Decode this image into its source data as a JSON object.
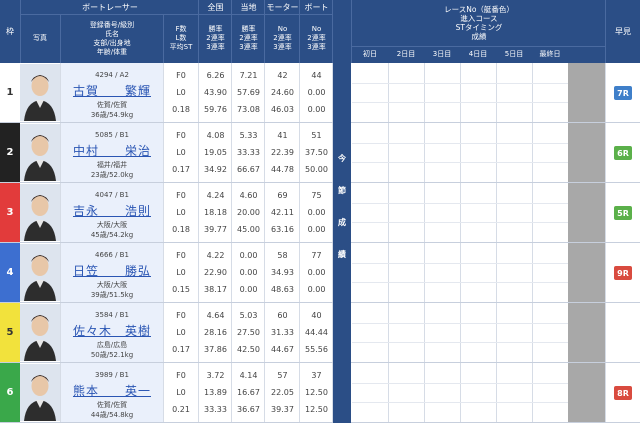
{
  "header": {
    "frame": "枠",
    "photo": "写真",
    "boat_racer": "ボートレーサー",
    "racer_info": "登録番号/級別\n氏名\n支部/出身地\n年齢/体重",
    "st_info": "F数\nL数\n平均ST",
    "national": "全国",
    "national_sub": "勝率\n2連率\n3連率",
    "local": "当地",
    "local_sub": "勝率\n2連率\n3連率",
    "motor": "モーター",
    "motor_sub": "No\n2連率\n3連率",
    "boat": "ボート",
    "boat_sub": "No\n2連率\n3連率",
    "race_header": "レースNo（艇番色）\n進入コース\nSTタイミング\n成績",
    "days": [
      "初日",
      "2日目",
      "3日目",
      "4日目",
      "5日目",
      "最終日"
    ],
    "early": "早見"
  },
  "side_label": [
    "今",
    "節",
    "成",
    "績"
  ],
  "racers": [
    {
      "frame": "1",
      "frame_color": "#ffffff",
      "frame_text": "#333333",
      "reg": "4294 / A2",
      "name": "古賀　　繁輝",
      "branch": "佐賀/佐賀",
      "age": "36歳/54.9kg",
      "f": "F0",
      "l": "L0",
      "st": "0.18",
      "national": [
        "6.26",
        "43.90",
        "59.76"
      ],
      "local": [
        "7.21",
        "57.69",
        "73.08"
      ],
      "motor": [
        "42",
        "24.60",
        "46.03"
      ],
      "boat": [
        "44",
        "0.00",
        "0.00"
      ],
      "early": "7R",
      "early_color": "#3f7fc9"
    },
    {
      "frame": "2",
      "frame_color": "#222222",
      "frame_text": "#ffffff",
      "reg": "5085 / B1",
      "name": "中村　　栄治",
      "branch": "福井/福井",
      "age": "23歳/52.0kg",
      "f": "F0",
      "l": "L0",
      "st": "0.17",
      "national": [
        "4.08",
        "19.05",
        "34.92"
      ],
      "local": [
        "5.33",
        "33.33",
        "66.67"
      ],
      "motor": [
        "41",
        "22.39",
        "44.78"
      ],
      "boat": [
        "51",
        "37.50",
        "50.00"
      ],
      "early": "6R",
      "early_color": "#5bb04a"
    },
    {
      "frame": "3",
      "frame_color": "#e23b3b",
      "frame_text": "#ffffff",
      "reg": "4047 / B1",
      "name": "吉永　　浩則",
      "branch": "大阪/大阪",
      "age": "45歳/54.2kg",
      "f": "F0",
      "l": "L0",
      "st": "0.18",
      "national": [
        "4.24",
        "18.18",
        "39.77"
      ],
      "local": [
        "4.60",
        "20.00",
        "45.00"
      ],
      "motor": [
        "69",
        "42.11",
        "63.16"
      ],
      "boat": [
        "75",
        "0.00",
        "0.00"
      ],
      "early": "5R",
      "early_color": "#5bb04a"
    },
    {
      "frame": "4",
      "frame_color": "#3d6fd0",
      "frame_text": "#ffffff",
      "reg": "4666 / B1",
      "name": "日笠　　勝弘",
      "branch": "大阪/大阪",
      "age": "39歳/51.5kg",
      "f": "F0",
      "l": "L0",
      "st": "0.15",
      "national": [
        "4.22",
        "22.90",
        "38.17"
      ],
      "local": [
        "0.00",
        "0.00",
        "0.00"
      ],
      "motor": [
        "58",
        "34.93",
        "48.63"
      ],
      "boat": [
        "77",
        "0.00",
        "0.00"
      ],
      "early": "9R",
      "early_color": "#d94b3f"
    },
    {
      "frame": "5",
      "frame_color": "#f2e23c",
      "frame_text": "#333333",
      "reg": "3584 / B1",
      "name": "佐々木　英樹",
      "branch": "広島/広島",
      "age": "50歳/52.1kg",
      "f": "F0",
      "l": "L0",
      "st": "0.17",
      "national": [
        "4.64",
        "28.16",
        "37.86"
      ],
      "local": [
        "5.03",
        "27.50",
        "42.50"
      ],
      "motor": [
        "60",
        "31.33",
        "44.67"
      ],
      "boat": [
        "40",
        "44.44",
        "55.56"
      ],
      "early": "",
      "early_color": ""
    },
    {
      "frame": "6",
      "frame_color": "#3aa84a",
      "frame_text": "#ffffff",
      "reg": "3989 / B1",
      "name": "熊本　　英一",
      "branch": "佐賀/佐賀",
      "age": "44歳/54.8kg",
      "f": "F0",
      "l": "L0",
      "st": "0.21",
      "national": [
        "3.72",
        "13.89",
        "33.33"
      ],
      "local": [
        "4.14",
        "16.67",
        "36.67"
      ],
      "motor": [
        "57",
        "22.05",
        "39.37"
      ],
      "boat": [
        "37",
        "12.50",
        "12.50"
      ],
      "early": "8R",
      "early_color": "#d94b3f"
    }
  ]
}
